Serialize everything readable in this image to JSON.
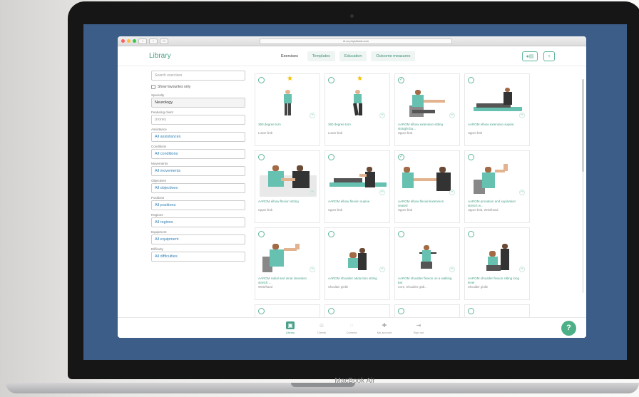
{
  "device": {
    "brand": "MacBook Air"
  },
  "browser": {
    "url": "id.co.physitrack.com"
  },
  "app": {
    "title": "Library",
    "tabs": [
      "Exercises",
      "Templates",
      "Education",
      "Outcome measures"
    ],
    "accent": "#48a08a"
  },
  "sidebar": {
    "search_placeholder": "Search exercises",
    "favourites_label": "Show favourites only",
    "filters": [
      {
        "label": "Specialty",
        "value": "Neurology"
      },
      {
        "label": "Featuring client",
        "value": "(none)"
      },
      {
        "label": "Assistance",
        "value": "All assistances"
      },
      {
        "label": "Conditions",
        "value": "All conditions"
      },
      {
        "label": "Movements",
        "value": "All movements"
      },
      {
        "label": "Objectives",
        "value": "All objectives"
      },
      {
        "label": "Positions",
        "value": "All positions"
      },
      {
        "label": "Regions",
        "value": "All regions"
      },
      {
        "label": "Equipment",
        "value": "All equipment"
      },
      {
        "label": "Difficulty",
        "value": "All difficulties"
      }
    ]
  },
  "exercises": [
    {
      "name": "360 degree turn",
      "meta": "Lower limb",
      "starred": true,
      "selected": false
    },
    {
      "name": "360 degree turn",
      "meta": "Lower limb",
      "starred": true,
      "selected": false
    },
    {
      "name": "AAROM elbow extension sitting straight ba...",
      "meta": "Upper limb",
      "starred": false,
      "selected": true
    },
    {
      "name": "AAROM elbow extension supine",
      "meta": "Upper limb",
      "starred": false,
      "selected": false
    },
    {
      "name": "AAROM elbow flexion sitting",
      "meta": "Upper limb",
      "starred": false,
      "selected": false
    },
    {
      "name": "AAROM elbow flexion supine",
      "meta": "Upper limb",
      "starred": false,
      "selected": false
    },
    {
      "name": "AAROM elbow flexion/extension seated",
      "meta": "Upper limb",
      "starred": false,
      "selected": true
    },
    {
      "name": "AAROM pronation and supination stretch w...",
      "meta": "Upper limb, Wrist/hand",
      "starred": false,
      "selected": false
    },
    {
      "name": "AAROM radial and ulnar deviation stretch ...",
      "meta": "Wrist/hand",
      "starred": false,
      "selected": false
    },
    {
      "name": "AAROM shoulder abduction sitting",
      "meta": "Shoulder girdle",
      "starred": false,
      "selected": false
    },
    {
      "name": "AAROM shoulder flexion on a walking bar",
      "meta": "Core, Shoulder girdl...",
      "starred": false,
      "selected": false
    },
    {
      "name": "AAROM shoulder flexion sitting long lever",
      "meta": "Shoulder girdle",
      "starred": false,
      "selected": false
    },
    {
      "name": "",
      "meta": "",
      "starred": false,
      "selected": false
    },
    {
      "name": "",
      "meta": "",
      "starred": false,
      "selected": false
    },
    {
      "name": "",
      "meta": "",
      "starred": false,
      "selected": false
    },
    {
      "name": "",
      "meta": "",
      "starred": false,
      "selected": false
    }
  ],
  "bottom_nav": [
    "Library",
    "Clients",
    "Connect",
    "My account",
    "Sign out"
  ],
  "help_label": "?"
}
